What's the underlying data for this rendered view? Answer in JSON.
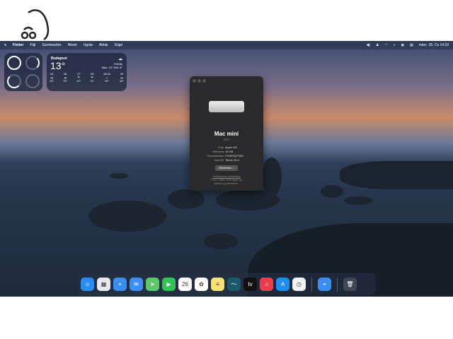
{
  "logo": {
    "name": "apple-face-logo"
  },
  "menubar": {
    "app": "Finder",
    "items": [
      "Fájl",
      "Szerkesztés",
      "Nézet",
      "Ugrás",
      "Ablak",
      "Súgó"
    ],
    "datetime": "márc. 26. Cs 14:33"
  },
  "weather": {
    "city": "Budapest",
    "temp": "13°",
    "condition": "Felhős",
    "range": "Max: 13° Min: 6°",
    "hours": [
      {
        "t": "15",
        "v": "13°"
      },
      {
        "t": "16",
        "v": "13°"
      },
      {
        "t": "17",
        "v": "12°"
      },
      {
        "t": "18",
        "v": "11°"
      },
      {
        "t": "18:04",
        "v": "10°"
      },
      {
        "t": "19",
        "v": "10°"
      }
    ]
  },
  "about": {
    "title": "Mac mini",
    "year": "2023",
    "specs": [
      {
        "k": "Chip",
        "v": "Apple M2"
      },
      {
        "k": "Memória",
        "v": "16 GB"
      },
      {
        "k": "Sorozatszám",
        "v": "FVNE0QY90D"
      },
      {
        "k": "macOS",
        "v": "Tahoe 26.4"
      }
    ],
    "button": "Bővebben...",
    "link": "Szabályozási tanúsítvány",
    "copyright": "™ és © 1983–2026 Apple Inc.",
    "rights": "Minden jog fenntartva."
  },
  "dock": {
    "apps": [
      {
        "name": "finder",
        "label": "☺",
        "color": "#2a8cf0"
      },
      {
        "name": "launchpad",
        "label": "▦",
        "color": "#e8e8ee"
      },
      {
        "name": "safari",
        "label": "⌖",
        "color": "#3a8ef0"
      },
      {
        "name": "mail",
        "label": "✉",
        "color": "#3c8ef5"
      },
      {
        "name": "maps",
        "label": "➤",
        "color": "#5cc86a"
      },
      {
        "name": "facetime",
        "label": "▶",
        "color": "#2fc454"
      },
      {
        "name": "calendar",
        "label": "26",
        "color": "#ffffff"
      },
      {
        "name": "photos",
        "label": "✿",
        "color": "#ffffff"
      },
      {
        "name": "notes",
        "label": "≡",
        "color": "#f7e27a"
      },
      {
        "name": "freeform",
        "label": "〜",
        "color": "#1a5a6a"
      },
      {
        "name": "tv",
        "label": "tv",
        "color": "#111111"
      },
      {
        "name": "music",
        "label": "♫",
        "color": "#f03a4e"
      },
      {
        "name": "app-store",
        "label": "A",
        "color": "#1e8cf5"
      },
      {
        "name": "clock",
        "label": "◷",
        "color": "#f2f2f2"
      }
    ],
    "recent": [
      {
        "name": "safari-downloads",
        "label": "⌖",
        "color": "#3a8ef0"
      }
    ],
    "trash": {
      "name": "trash",
      "label": "🗑"
    }
  }
}
